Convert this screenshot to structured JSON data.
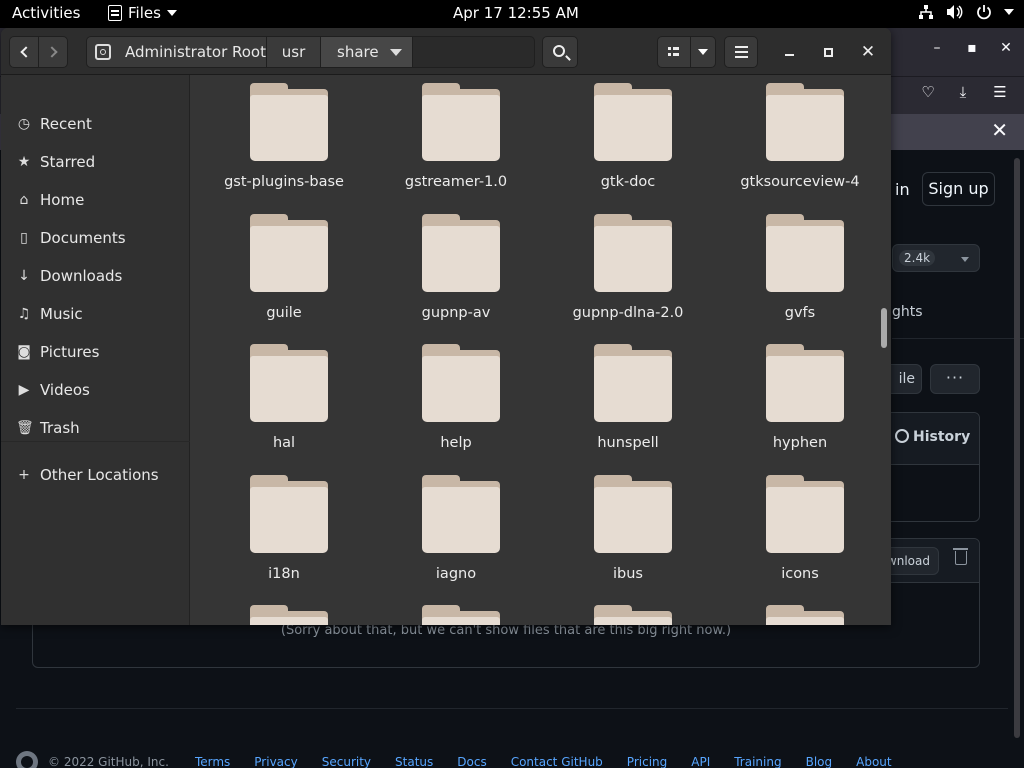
{
  "topbar": {
    "activities": "Activities",
    "app": "Files",
    "clock": "Apr 17  12:55 AM",
    "tray_icons": [
      "network-icon",
      "volume-icon",
      "power-icon"
    ]
  },
  "browser": {
    "sign_in": "in",
    "sign_up": "Sign up",
    "star_count": "2.4k",
    "insights": "ghts",
    "file_btn": "ile",
    "more_btn": "···",
    "history": "History",
    "download": "wnload",
    "too_big_message": "(Sorry about that, but we can't show files that are this big right now.)",
    "footer_copyright": "© 2022 GitHub, Inc.",
    "footer_links": [
      "Terms",
      "Privacy",
      "Security",
      "Status",
      "Docs",
      "Contact GitHub",
      "Pricing",
      "API",
      "Training",
      "Blog",
      "About"
    ]
  },
  "nautilus": {
    "path": [
      "Administrator Root",
      "usr",
      "share"
    ],
    "sidebar": [
      {
        "label": "Recent",
        "icon": "clock-icon"
      },
      {
        "label": "Starred",
        "icon": "star-icon"
      },
      {
        "label": "Home",
        "icon": "home-icon"
      },
      {
        "label": "Documents",
        "icon": "document-icon"
      },
      {
        "label": "Downloads",
        "icon": "download-icon"
      },
      {
        "label": "Music",
        "icon": "music-icon"
      },
      {
        "label": "Pictures",
        "icon": "camera-icon"
      },
      {
        "label": "Videos",
        "icon": "video-icon"
      },
      {
        "label": "Trash",
        "icon": "trash-icon"
      },
      {
        "label": "Other Locations",
        "icon": "plus-icon"
      }
    ],
    "folders": [
      "gst-plugins-base",
      "gstreamer-1.0",
      "gtk-doc",
      "gtksourceview-4",
      "guile",
      "gupnp-av",
      "gupnp-dlna-2.0",
      "gvfs",
      "hal",
      "help",
      "hunspell",
      "hyphen",
      "i18n",
      "iagno",
      "ibus",
      "icons",
      "",
      "",
      "",
      ""
    ]
  },
  "colors": {
    "folder_body": "#e6dcd2",
    "folder_tab": "#c8b7a6",
    "window_bg": "#353535",
    "sidebar_bg": "#303030",
    "link_blue": "#58a6ff"
  }
}
